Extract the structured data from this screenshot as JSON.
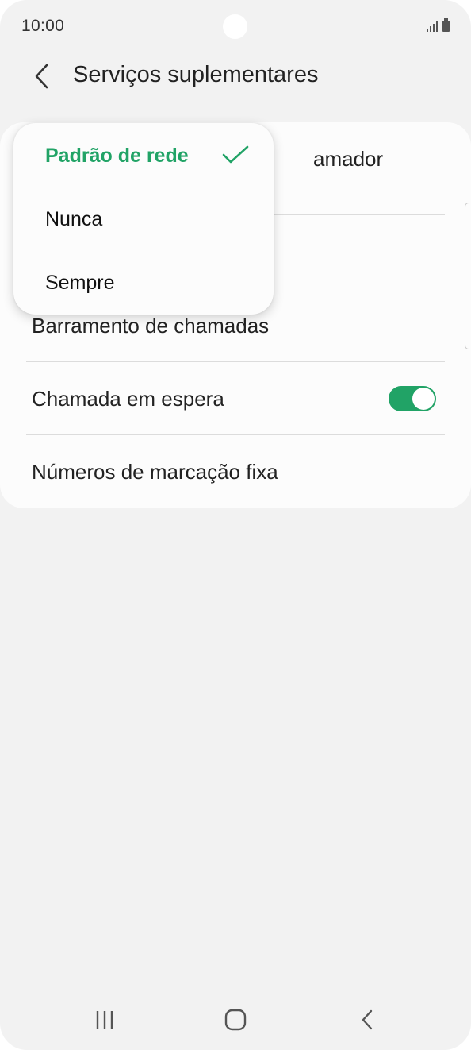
{
  "status_bar": {
    "time": "10:00",
    "icons": [
      "signal-icon",
      "battery-icon"
    ]
  },
  "header": {
    "back_icon": "chevron-left-icon",
    "title": "Serviços suplementares"
  },
  "settings": {
    "items": [
      {
        "label": "Mostrar ID do chamador",
        "visible_label": "amador"
      },
      {
        "label": "Barramento de chamadas"
      },
      {
        "label": "Chamada em espera",
        "toggle_on": true
      },
      {
        "label": "Números de marcação fixa"
      }
    ]
  },
  "popup_menu": {
    "options": [
      {
        "label": "Padrão de rede",
        "selected": true
      },
      {
        "label": "Nunca",
        "selected": false
      },
      {
        "label": "Sempre",
        "selected": false
      }
    ]
  },
  "nav_bar": {
    "buttons": [
      "recents-icon",
      "home-icon",
      "back-icon"
    ]
  },
  "colors": {
    "accent": "#21a366",
    "background": "#f2f2f2",
    "card": "#fcfcfc",
    "text": "#222222"
  }
}
